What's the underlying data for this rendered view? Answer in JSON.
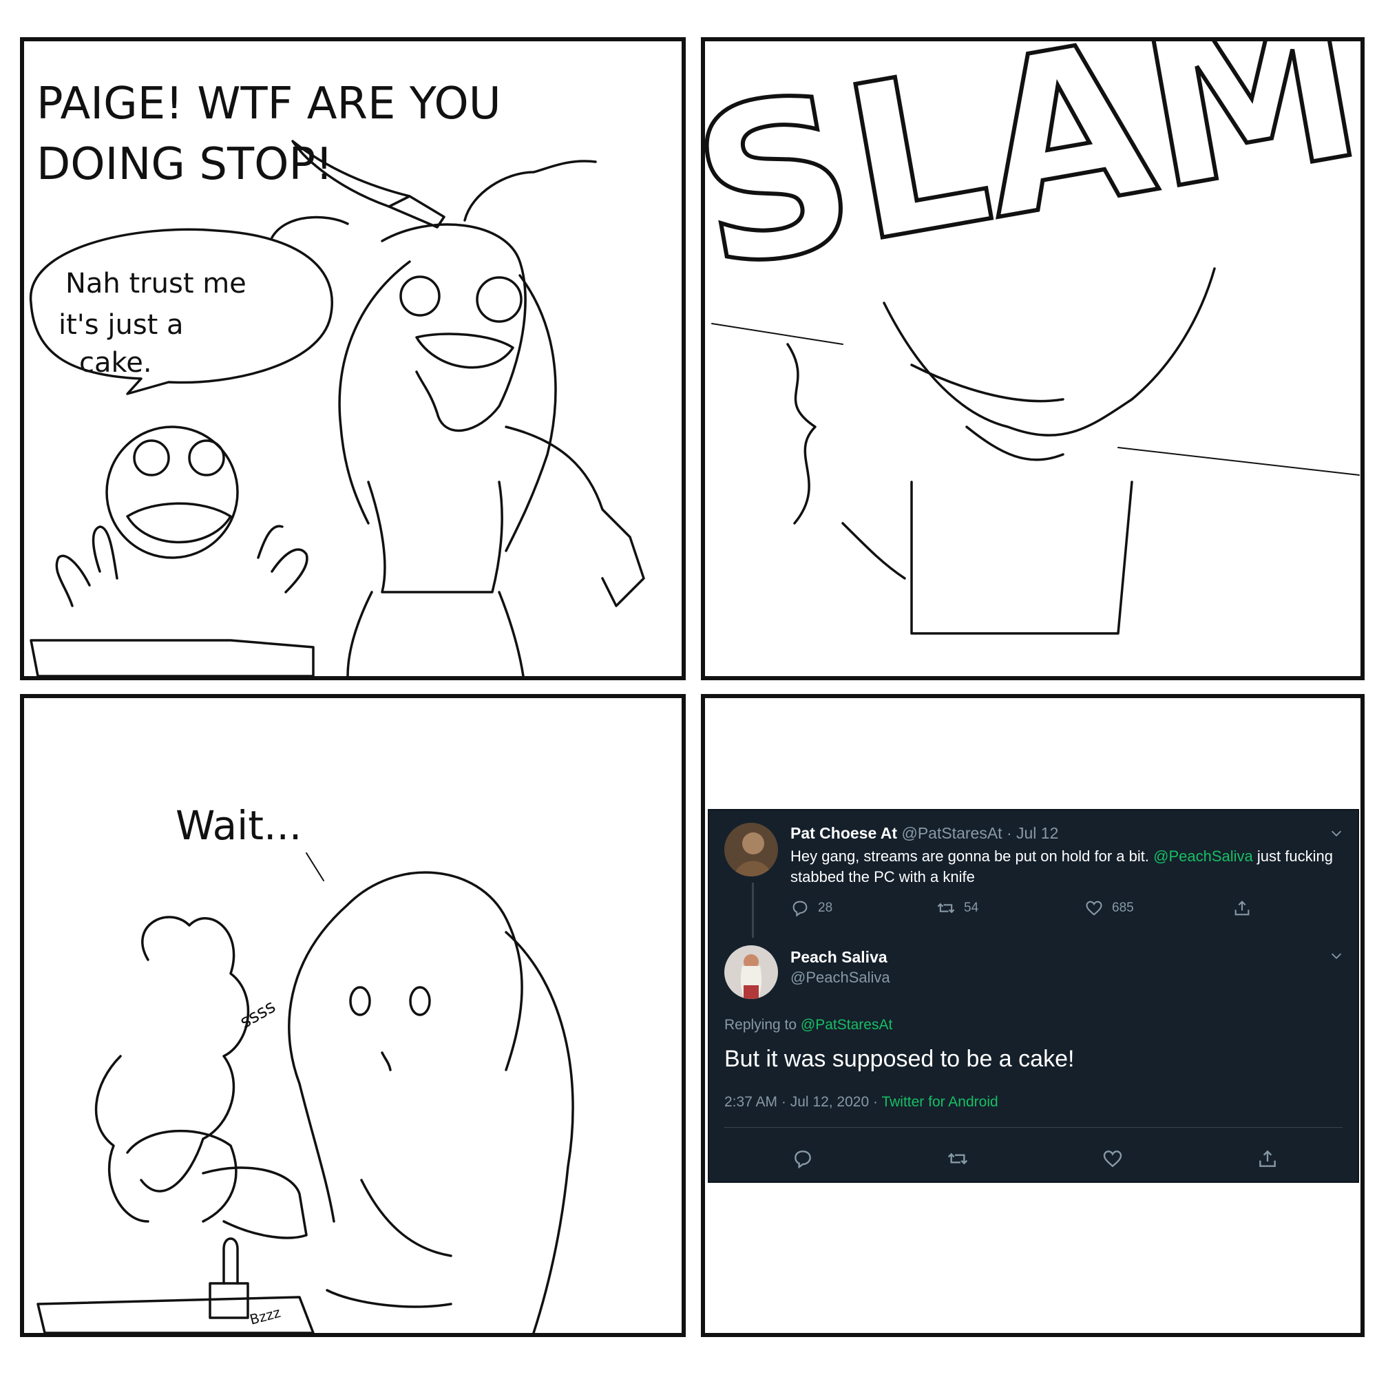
{
  "comic": {
    "panel1": {
      "shout_line1": "PAIGE! WTF ARE YOU",
      "shout_line2": "DOING STOP!",
      "reply_line1": "Nah trust me",
      "reply_line2": "it's just a",
      "reply_line3": "cake."
    },
    "panel2": {
      "sfx": "SLAM"
    },
    "panel3": {
      "speech": "Wait...",
      "sfx_sizzle": "ssss",
      "sfx_buzz": "Bzzz"
    }
  },
  "tweet": {
    "original": {
      "display_name": "Pat Choese At",
      "handle": "@PatStaresAt",
      "date": "· Jul 12",
      "text_part1": "Hey gang, streams are gonna be put on hold for a bit.",
      "mention": "@PeachSaliva",
      "text_part2": "just fucking stabbed the PC with a knife",
      "replies": "28",
      "retweets": "54",
      "likes": "685"
    },
    "reply": {
      "display_name": "Peach Saliva",
      "handle": "@PeachSaliva",
      "replying_label": "Replying to",
      "replying_to": "@PatStaresAt",
      "text": "But it was supposed to be a cake!",
      "timestamp": "2:37 AM · Jul 12, 2020 ·",
      "client": "Twitter for Android"
    },
    "colors": {
      "background": "#15202b",
      "link": "#17bf63",
      "muted": "#8899a6"
    },
    "icons": [
      "reply-icon",
      "retweet-icon",
      "like-icon",
      "share-icon",
      "chevron-down-icon"
    ]
  }
}
